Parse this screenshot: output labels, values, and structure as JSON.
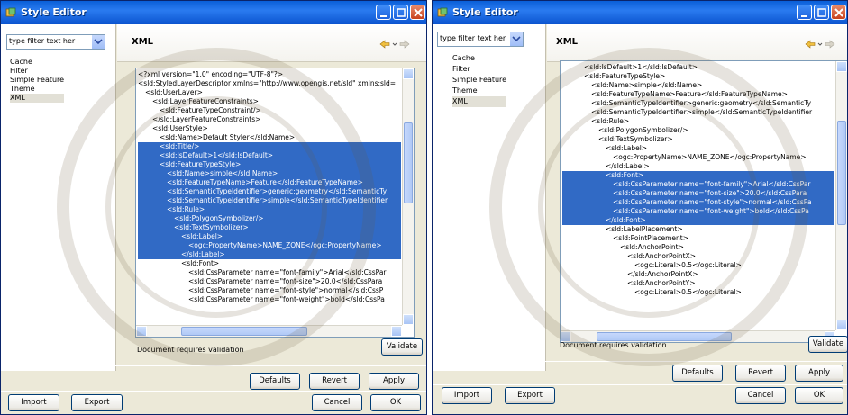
{
  "left_window": {
    "title": "Style Editor",
    "filter_placeholder": "type filter text her",
    "nav_items": [
      "Cache",
      "Filter",
      "Simple Feature",
      "Theme",
      "XML"
    ],
    "selected_nav": "XML",
    "section_title": "XML",
    "code_lines": [
      {
        "text": "<?xml version=\"1.0\" encoding=\"UTF-8\"?>",
        "indent": 0,
        "hl": false
      },
      {
        "text": "<sld:StyledLayerDescriptor xmlns=\"http://www.opengis.net/sld\" xmlns:sld=",
        "indent": 0,
        "hl": false
      },
      {
        "text": "<sld:UserLayer>",
        "indent": 1,
        "hl": false
      },
      {
        "text": "<sld:LayerFeatureConstraints>",
        "indent": 2,
        "hl": false
      },
      {
        "text": "<sld:FeatureTypeConstraint/>",
        "indent": 3,
        "hl": false
      },
      {
        "text": "</sld:LayerFeatureConstraints>",
        "indent": 2,
        "hl": false
      },
      {
        "text": "<sld:UserStyle>",
        "indent": 2,
        "hl": false
      },
      {
        "text": "<sld:Name>Default Styler</sld:Name>",
        "indent": 3,
        "hl": false
      },
      {
        "text": "<sld:Title/>",
        "indent": 3,
        "hl": true
      },
      {
        "text": "<sld:IsDefault>1</sld:IsDefault>",
        "indent": 3,
        "hl": true
      },
      {
        "text": "<sld:FeatureTypeStyle>",
        "indent": 3,
        "hl": true
      },
      {
        "text": "<sld:Name>simple</sld:Name>",
        "indent": 4,
        "hl": true
      },
      {
        "text": "<sld:FeatureTypeName>Feature</sld:FeatureTypeName>",
        "indent": 4,
        "hl": true
      },
      {
        "text": "<sld:SemanticTypeIdentifier>generic:geometry</sld:SemanticTy",
        "indent": 4,
        "hl": true
      },
      {
        "text": "<sld:SemanticTypeIdentifier>simple</sld:SemanticTypeIdentifier",
        "indent": 4,
        "hl": true
      },
      {
        "text": "<sld:Rule>",
        "indent": 4,
        "hl": true
      },
      {
        "text": "<sld:PolygonSymbolizer/>",
        "indent": 5,
        "hl": true
      },
      {
        "text": "<sld:TextSymbolizer>",
        "indent": 5,
        "hl": true
      },
      {
        "text": "<sld:Label>",
        "indent": 6,
        "hl": true
      },
      {
        "text": "<ogc:PropertyName>NAME_ZONE</ogc:PropertyName>",
        "indent": 7,
        "hl": true
      },
      {
        "text": "</sld:Label>",
        "indent": 6,
        "hl": true
      },
      {
        "text": "<sld:Font>",
        "indent": 6,
        "hl": false
      },
      {
        "text": "<sld:CssParameter name=\"font-family\">Arial</sld:CssPar",
        "indent": 7,
        "hl": false
      },
      {
        "text": "<sld:CssParameter name=\"font-size\">20.0</sld:CssPara",
        "indent": 7,
        "hl": false
      },
      {
        "text": "<sld:CssParameter name=\"font-style\">normal</sld:CssP",
        "indent": 7,
        "hl": false
      },
      {
        "text": "<sld:CssParameter name=\"font-weight\">bold</sld:CssPa",
        "indent": 7,
        "hl": false
      }
    ],
    "status_text": "Document requires validation",
    "validate_label": "Validate",
    "defaults_label": "Defaults",
    "revert_label": "Revert",
    "apply_label": "Apply",
    "import_label": "Import",
    "export_label": "Export",
    "cancel_label": "Cancel",
    "ok_label": "OK"
  },
  "right_window": {
    "title": "Style Editor",
    "filter_placeholder": "type filter text her",
    "nav_items": [
      "Cache",
      "Filter",
      "Simple Feature",
      "Theme",
      "XML"
    ],
    "selected_nav": "XML",
    "section_title": "XML",
    "code_lines": [
      {
        "text": "<sld:IsDefault>1</sld:IsDefault>",
        "indent": 3,
        "hl": false
      },
      {
        "text": "<sld:FeatureTypeStyle>",
        "indent": 3,
        "hl": false
      },
      {
        "text": "<sld:Name>simple</sld:Name>",
        "indent": 4,
        "hl": false
      },
      {
        "text": "<sld:FeatureTypeName>Feature</sld:FeatureTypeName>",
        "indent": 4,
        "hl": false
      },
      {
        "text": "<sld:SemanticTypeIdentifier>generic:geometry</sld:SemanticTy",
        "indent": 4,
        "hl": false
      },
      {
        "text": "<sld:SemanticTypeIdentifier>simple</sld:SemanticTypeIdentifier",
        "indent": 4,
        "hl": false
      },
      {
        "text": "<sld:Rule>",
        "indent": 4,
        "hl": false
      },
      {
        "text": "<sld:PolygonSymbolizer/>",
        "indent": 5,
        "hl": false
      },
      {
        "text": "<sld:TextSymbolizer>",
        "indent": 5,
        "hl": false
      },
      {
        "text": "<sld:Label>",
        "indent": 6,
        "hl": false
      },
      {
        "text": "<ogc:PropertyName>NAME_ZONE</ogc:PropertyName>",
        "indent": 7,
        "hl": false
      },
      {
        "text": "</sld:Label>",
        "indent": 6,
        "hl": false
      },
      {
        "text": "<sld:Font>",
        "indent": 6,
        "hl": true
      },
      {
        "text": "<sld:CssParameter name=\"font-family\">Arial</sld:CssPar",
        "indent": 7,
        "hl": true
      },
      {
        "text": "<sld:CssParameter name=\"font-size\">20.0</sld:CssPara",
        "indent": 7,
        "hl": true
      },
      {
        "text": "<sld:CssParameter name=\"font-style\">normal</sld:CssPa",
        "indent": 7,
        "hl": true
      },
      {
        "text": "<sld:CssParameter name=\"font-weight\">bold</sld:CssPa",
        "indent": 7,
        "hl": true
      },
      {
        "text": "</sld:Font>",
        "indent": 6,
        "hl": true
      },
      {
        "text": "<sld:LabelPlacement>",
        "indent": 6,
        "hl": false
      },
      {
        "text": "<sld:PointPlacement>",
        "indent": 7,
        "hl": false
      },
      {
        "text": "<sld:AnchorPoint>",
        "indent": 8,
        "hl": false
      },
      {
        "text": "<sld:AnchorPointX>",
        "indent": 9,
        "hl": false
      },
      {
        "text": "<ogc:Literal>0.5</ogc:Literal>",
        "indent": 10,
        "hl": false
      },
      {
        "text": "</sld:AnchorPointX>",
        "indent": 9,
        "hl": false
      },
      {
        "text": "<sld:AnchorPointY>",
        "indent": 9,
        "hl": false
      },
      {
        "text": "<ogc:Literal>0.5</ogc:Literal>",
        "indent": 10,
        "hl": false
      }
    ],
    "status_text": "Document requires validation",
    "validate_label": "Validate",
    "defaults_label": "Defaults",
    "revert_label": "Revert",
    "apply_label": "Apply",
    "import_label": "Import",
    "export_label": "Export",
    "cancel_label": "Cancel",
    "ok_label": "OK"
  },
  "colors": {
    "titlebar": "#0a5fd8",
    "selection": "#316ac5",
    "dialog_bg": "#ece9d8"
  }
}
